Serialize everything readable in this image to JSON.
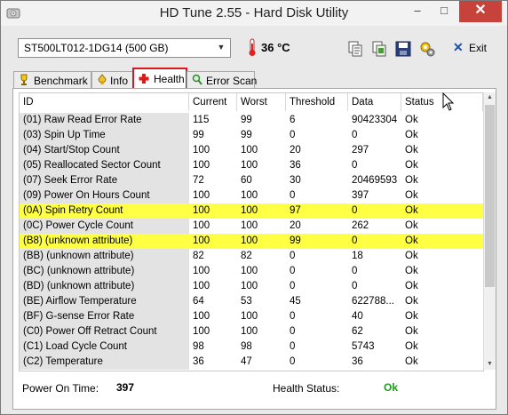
{
  "window": {
    "title": "HD Tune 2.55 - Hard Disk Utility",
    "minimize_glyph": "–",
    "maximize_glyph": "□",
    "close_glyph": "✕"
  },
  "toolbar": {
    "drive": "ST500LT012-1DG14 (500 GB)",
    "temperature": "36 °C",
    "exit_label": "Exit",
    "icons": [
      "copy-text-icon",
      "copy-screenshot-icon",
      "save-icon",
      "options-icon",
      "exit-icon"
    ]
  },
  "tabs": [
    {
      "label": "Benchmark",
      "icon": "benchmark-icon"
    },
    {
      "label": "Info",
      "icon": "info-icon"
    },
    {
      "label": "Health",
      "icon": "health-cross-icon"
    },
    {
      "label": "Error Scan",
      "icon": "magnifier-icon"
    }
  ],
  "active_tab": "Health",
  "colors": {
    "highlight_row": "#ffff44",
    "active_tab_border": "#e0141e",
    "status_ok": "#17a317",
    "close_button": "#c7423b"
  },
  "table": {
    "columns": [
      "ID",
      "Current",
      "Worst",
      "Threshold",
      "Data",
      "Status"
    ],
    "rows": [
      {
        "id": "(01) Raw Read Error Rate",
        "current": "115",
        "worst": "99",
        "threshold": "6",
        "data": "90423304",
        "status": "Ok",
        "highlight": false
      },
      {
        "id": "(03) Spin Up Time",
        "current": "99",
        "worst": "99",
        "threshold": "0",
        "data": "0",
        "status": "Ok",
        "highlight": false
      },
      {
        "id": "(04) Start/Stop Count",
        "current": "100",
        "worst": "100",
        "threshold": "20",
        "data": "297",
        "status": "Ok",
        "highlight": false
      },
      {
        "id": "(05) Reallocated Sector Count",
        "current": "100",
        "worst": "100",
        "threshold": "36",
        "data": "0",
        "status": "Ok",
        "highlight": false
      },
      {
        "id": "(07) Seek Error Rate",
        "current": "72",
        "worst": "60",
        "threshold": "30",
        "data": "20469593",
        "status": "Ok",
        "highlight": false
      },
      {
        "id": "(09) Power On Hours Count",
        "current": "100",
        "worst": "100",
        "threshold": "0",
        "data": "397",
        "status": "Ok",
        "highlight": false
      },
      {
        "id": "(0A) Spin Retry Count",
        "current": "100",
        "worst": "100",
        "threshold": "97",
        "data": "0",
        "status": "Ok",
        "highlight": true
      },
      {
        "id": "(0C) Power Cycle Count",
        "current": "100",
        "worst": "100",
        "threshold": "20",
        "data": "262",
        "status": "Ok",
        "highlight": false
      },
      {
        "id": "(B8) (unknown attribute)",
        "current": "100",
        "worst": "100",
        "threshold": "99",
        "data": "0",
        "status": "Ok",
        "highlight": true
      },
      {
        "id": "(BB) (unknown attribute)",
        "current": "82",
        "worst": "82",
        "threshold": "0",
        "data": "18",
        "status": "Ok",
        "highlight": false
      },
      {
        "id": "(BC) (unknown attribute)",
        "current": "100",
        "worst": "100",
        "threshold": "0",
        "data": "0",
        "status": "Ok",
        "highlight": false
      },
      {
        "id": "(BD) (unknown attribute)",
        "current": "100",
        "worst": "100",
        "threshold": "0",
        "data": "0",
        "status": "Ok",
        "highlight": false
      },
      {
        "id": "(BE) Airflow Temperature",
        "current": "64",
        "worst": "53",
        "threshold": "45",
        "data": "622788...",
        "status": "Ok",
        "highlight": false
      },
      {
        "id": "(BF) G-sense Error Rate",
        "current": "100",
        "worst": "100",
        "threshold": "0",
        "data": "40",
        "status": "Ok",
        "highlight": false
      },
      {
        "id": "(C0) Power Off Retract Count",
        "current": "100",
        "worst": "100",
        "threshold": "0",
        "data": "62",
        "status": "Ok",
        "highlight": false
      },
      {
        "id": "(C1) Load Cycle Count",
        "current": "98",
        "worst": "98",
        "threshold": "0",
        "data": "5743",
        "status": "Ok",
        "highlight": false
      },
      {
        "id": "(C2) Temperature",
        "current": "36",
        "worst": "47",
        "threshold": "0",
        "data": "36",
        "status": "Ok",
        "highlight": false
      }
    ]
  },
  "status": {
    "power_on_label": "Power On Time:",
    "power_on_value": "397",
    "health_label": "Health Status:",
    "health_value": "Ok"
  }
}
